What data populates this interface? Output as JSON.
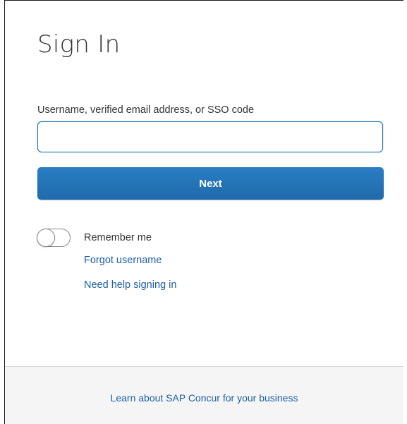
{
  "signin": {
    "title": "Sign In",
    "username_label": "Username, verified email address, or SSO code",
    "username_value": "",
    "username_placeholder": "",
    "next_label": "Next",
    "remember_label": "Remember me",
    "remember_on": false,
    "forgot_username": "Forgot username",
    "need_help": "Need help signing in"
  },
  "footer": {
    "learn_more": "Learn about SAP Concur for your business"
  },
  "colors": {
    "accent": "#1f6aab",
    "link": "#1d5fa8"
  }
}
